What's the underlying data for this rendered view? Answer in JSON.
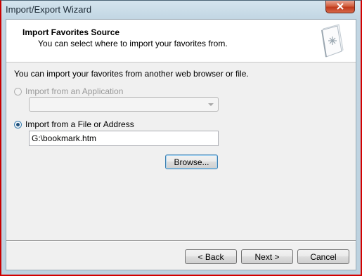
{
  "window": {
    "title": "Import/Export Wizard",
    "close_icon": "close-icon"
  },
  "header": {
    "title": "Import Favorites Source",
    "subtitle": "You can select where to import your favorites from.",
    "icon": "favorites-book-icon"
  },
  "body": {
    "intro": "You can import your favorites from another web browser or file.",
    "option_application": {
      "label": "Import from an Application",
      "selected": false,
      "enabled": false
    },
    "application_dropdown": {
      "value": ""
    },
    "option_file": {
      "label": "Import from a File or Address",
      "selected": true,
      "enabled": true
    },
    "file_path": {
      "value": "G:\\bookmark.htm"
    },
    "browse_label": "Browse..."
  },
  "footer": {
    "back_label": "< Back",
    "next_label": "Next >",
    "cancel_label": "Cancel"
  }
}
